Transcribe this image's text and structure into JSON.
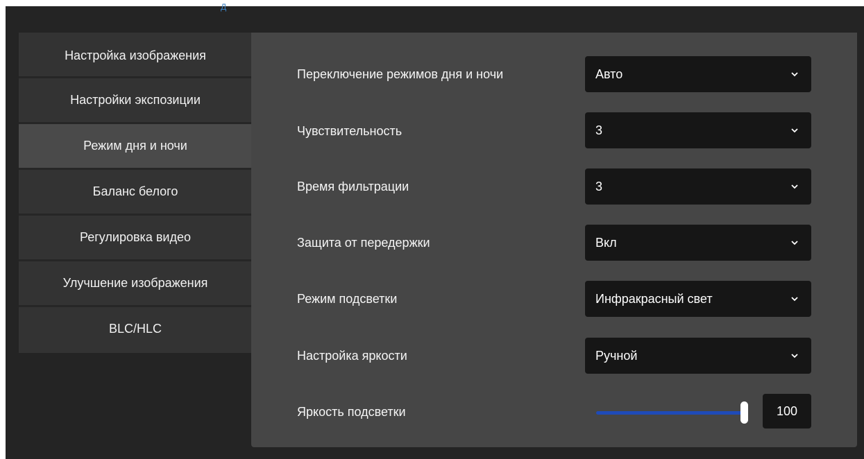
{
  "top_link": "Д",
  "sidebar": {
    "items": [
      {
        "label": "Настройка изображения",
        "active": false
      },
      {
        "label": "Настройки экспозиции",
        "active": false
      },
      {
        "label": "Режим дня и ночи",
        "active": true
      },
      {
        "label": "Баланс белого",
        "active": false
      },
      {
        "label": "Регулировка видео",
        "active": false
      },
      {
        "label": "Улучшение изображения",
        "active": false
      },
      {
        "label": "BLC/HLC",
        "active": false
      }
    ]
  },
  "settings": {
    "day_night": {
      "label": "Переключение режимов дня и ночи",
      "value": "Авто"
    },
    "sensitivity": {
      "label": "Чувствительность",
      "value": "3"
    },
    "filter_time": {
      "label": "Время фильтрации",
      "value": "3"
    },
    "overexposure": {
      "label": "Защита от передержки",
      "value": "Вкл"
    },
    "fill_light": {
      "label": "Режим подсветки",
      "value": "Инфракрасный свет"
    },
    "brightness_mode": {
      "label": "Настройка яркости",
      "value": "Ручной"
    },
    "fill_brightness": {
      "label": "Яркость подсветки",
      "value": "100",
      "level": 1.0
    }
  },
  "colors": {
    "accent": "#1f4bb8",
    "panel": "#464646",
    "sidebar": "#333333",
    "sidebar_active": "#4a4a4a"
  }
}
